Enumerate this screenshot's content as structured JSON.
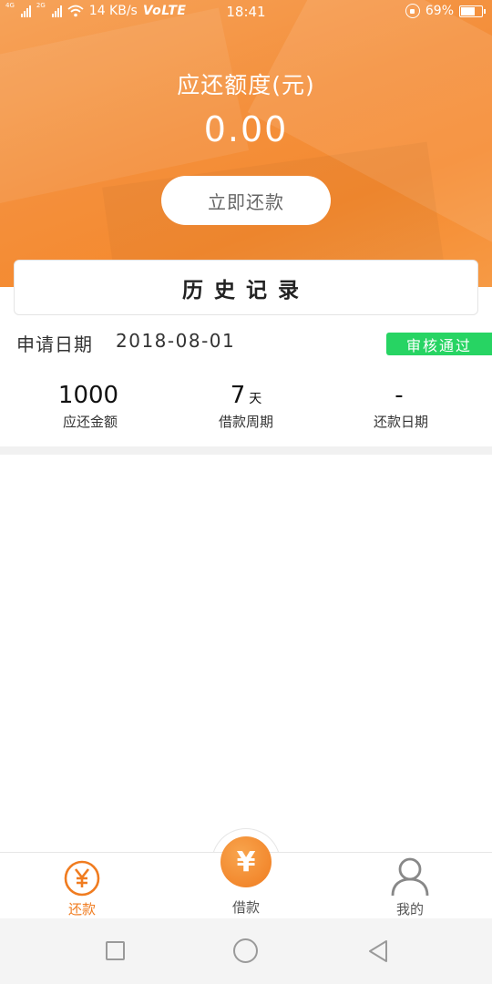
{
  "status_bar": {
    "network_tag_1": "4G",
    "network_tag_2": "2G",
    "speed": "14 KB/s",
    "volte": "VoLTE",
    "time": "18:41",
    "battery_percent": "69%",
    "battery_level": 0.69
  },
  "header": {
    "title": "应还额度(元)",
    "amount": "0.00",
    "repay_button": "立即还款"
  },
  "history": {
    "title": "历史记录"
  },
  "record": {
    "apply_label": "申请日期",
    "apply_date": "2018-08-01",
    "status_badge": "审核通过",
    "stats": [
      {
        "value": "1000",
        "unit": "",
        "label": "应还金额"
      },
      {
        "value": "7",
        "unit": "天",
        "label": "借款周期"
      },
      {
        "value": "-",
        "unit": "",
        "label": "还款日期"
      }
    ]
  },
  "tabbar": {
    "tabs": [
      {
        "label": "还款",
        "icon": "yen-circle-icon",
        "active": true
      },
      {
        "label": "借款",
        "icon": "yen-center-button-icon",
        "active": false
      },
      {
        "label": "我的",
        "icon": "user-icon",
        "active": false
      }
    ],
    "center_symbol": "¥",
    "active_color": "#f07c20",
    "inactive_color": "#555555"
  },
  "colors": {
    "accent": "#f48f3b",
    "badge": "#27d463"
  }
}
